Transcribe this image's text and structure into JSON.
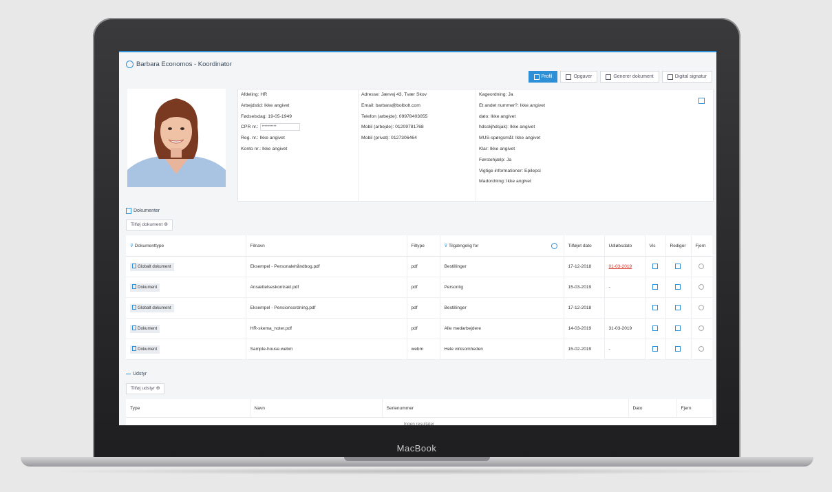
{
  "device": {
    "label": "MacBook"
  },
  "header": {
    "title": "Barbara Economos - Koordinator"
  },
  "tabs": [
    {
      "label": "Profil",
      "active": true
    },
    {
      "label": "Opgaver",
      "active": false
    },
    {
      "label": "Generer dokument",
      "active": false
    },
    {
      "label": "Digital signatur",
      "active": false
    }
  ],
  "profile": {
    "col1": [
      "Afdeling: HR",
      "Arbejdstid: Ikke angivet",
      "Fødselsdag: 19-05-1949",
      "CPR nr.:",
      "Reg. nr.: Ikke angivet",
      "Konto nr.: Ikke angivet"
    ],
    "cpr_value": "••••••••••",
    "col2": [
      "Adresse: Jærvej 43, Tvær Skov",
      "Email: barbara@bolbolt.com",
      "Telefon (arbejde): 09978403055",
      "Mobil (arbejde): 01209781768",
      "Mobil (privat): 0127306464"
    ],
    "col3": [
      "Kageordning: Ja",
      "Et andet nummer?: Ikke angivet",
      "dato: Ikke angivet",
      "hdsskjhdsjak): Ikke angivet",
      "MUS-spørgsmål: Ikke angivet",
      "Klar: Ikke angivet",
      "Førstehjælp: Ja",
      "Vigtige informationer: Epilepsi",
      "Madordning: Ikke angivet"
    ]
  },
  "documents": {
    "section_label": "Dokumenter",
    "add_label": "Tilføj dokument",
    "headers": [
      "Dokumenttype",
      "Filnavn",
      "Filtype",
      "Tilgængelig for",
      "Tilføjet dato",
      "Udløbsdato",
      "Vis",
      "Rediger",
      "Fjern"
    ],
    "rows": [
      {
        "type": "Globalt dokument",
        "file": "Eksempel - Personalehåndbog.pdf",
        "filetype": "pdf",
        "access": "Bestillinger",
        "added": "17-12-2018",
        "expires": "01-03-2019",
        "expired": true
      },
      {
        "type": "Dokument",
        "file": "Ansættelseskontrakt.pdf",
        "filetype": "pdf",
        "access": "Personlig",
        "added": "15-03-2019",
        "expires": "-",
        "expired": false
      },
      {
        "type": "Globalt dokument",
        "file": "Eksempel - Pensionsordning.pdf",
        "filetype": "pdf",
        "access": "Bestillinger",
        "added": "17-12-2018",
        "expires": "",
        "expired": false
      },
      {
        "type": "Dokument",
        "file": "HR-skema_noter.pdf",
        "filetype": "pdf",
        "access": "Alle medarbejdere",
        "added": "14-03-2019",
        "expires": "31-03-2019",
        "expired": false
      },
      {
        "type": "Dokument",
        "file": "Sample-house.webm",
        "filetype": "webm",
        "access": "Hele virksomheden",
        "added": "15-02-2019",
        "expires": "-",
        "expired": false
      }
    ]
  },
  "equipment": {
    "section_label": "Udstyr",
    "add_label": "Tilføj udstyr",
    "headers": [
      "Type",
      "Navn",
      "Serienummer",
      "Dato",
      "Fjern"
    ],
    "empty_text": "Ingen resultater"
  },
  "colors": {
    "accent": "#2d8fd5",
    "expired": "#d9342b"
  }
}
